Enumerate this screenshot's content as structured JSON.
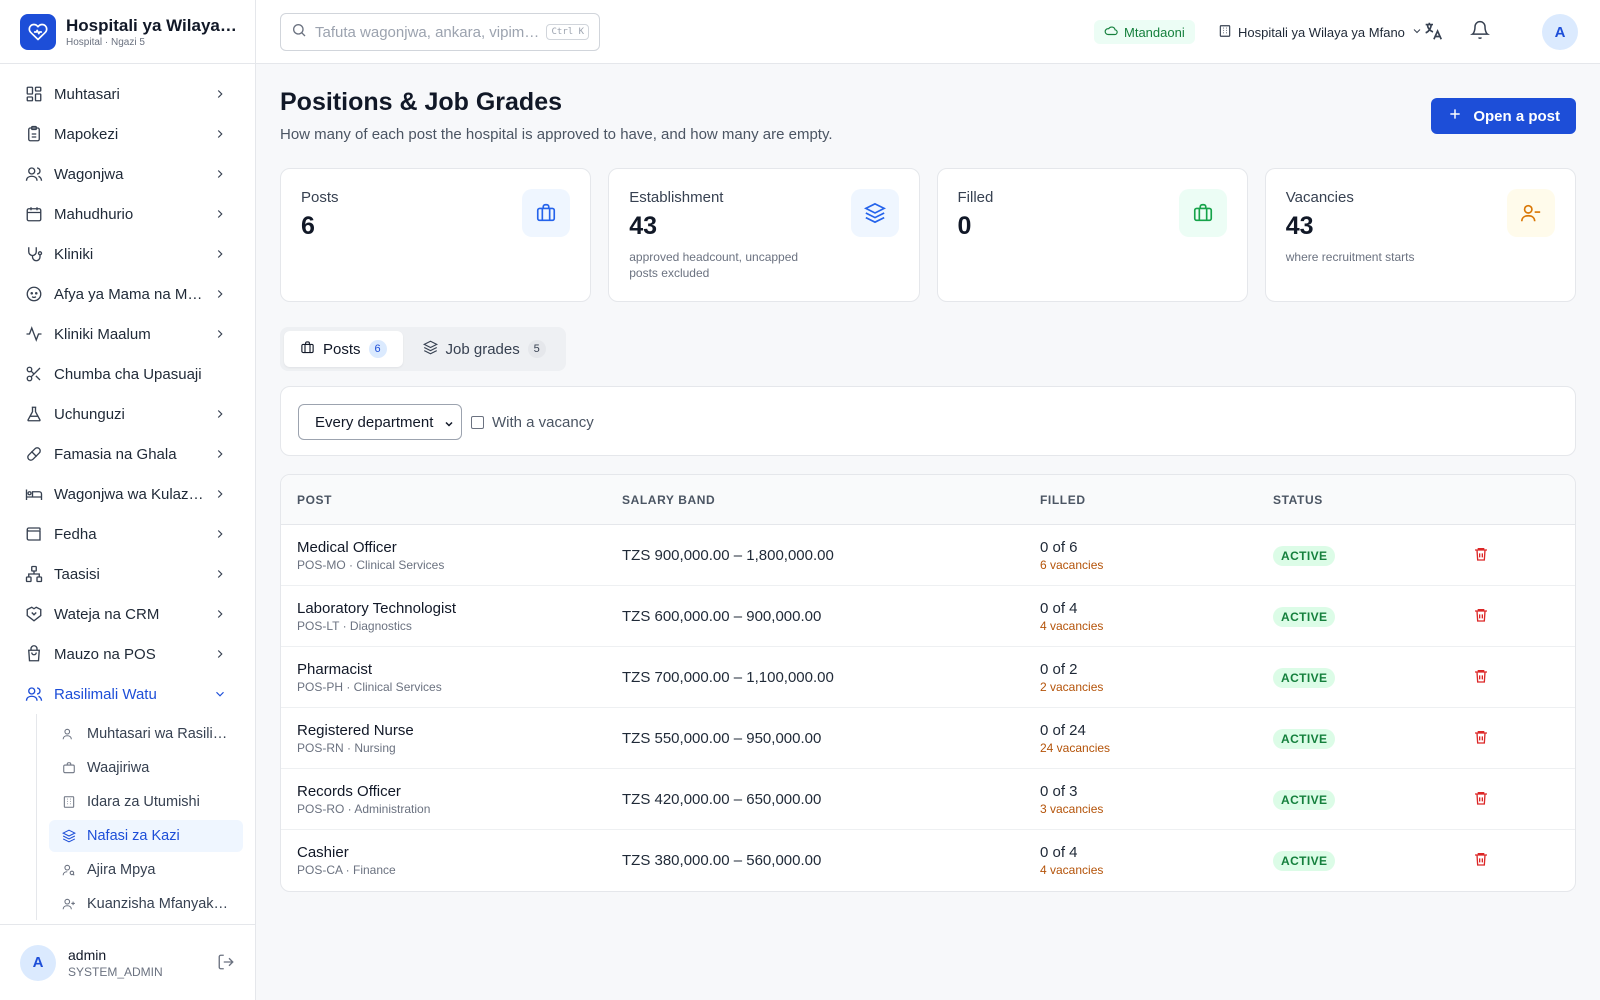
{
  "app": {
    "name": "Hospitali ya Wilaya ya Mfano",
    "subtitle": "Hospital · Ngazi 5",
    "colors": {
      "primary": "#1d4ed8",
      "success": "#15803d",
      "warning": "#b45309",
      "danger": "#dc2626"
    }
  },
  "topbar": {
    "search_placeholder": "Tafuta wagonjwa, ankara, vipimo...",
    "search_shortcut": "Ctrl K",
    "status": "Mtandaoni",
    "facility": "Hospitali ya Wilaya ya Mfano",
    "avatar_initial": "A"
  },
  "sidebar": {
    "items": [
      {
        "label": "Muhtasari",
        "icon": "dashboard-icon"
      },
      {
        "label": "Mapokezi",
        "icon": "clipboard-icon"
      },
      {
        "label": "Wagonjwa",
        "icon": "users-icon"
      },
      {
        "label": "Mahudhurio",
        "icon": "calendar-icon"
      },
      {
        "label": "Kliniki",
        "icon": "stethoscope-icon"
      },
      {
        "label": "Afya ya Mama na Mtoto",
        "icon": "baby-icon"
      },
      {
        "label": "Kliniki Maalum",
        "icon": "activity-icon"
      },
      {
        "label": "Chumba cha Upasuaji",
        "icon": "scissors-icon"
      },
      {
        "label": "Uchunguzi",
        "icon": "flask-icon"
      },
      {
        "label": "Famasia na Ghala",
        "icon": "pill-icon"
      },
      {
        "label": "Wagonjwa wa Kulazwa",
        "icon": "bed-icon"
      },
      {
        "label": "Fedha",
        "icon": "wallet-icon"
      },
      {
        "label": "Taasisi",
        "icon": "network-icon"
      },
      {
        "label": "Wateja na CRM",
        "icon": "handshake-icon"
      },
      {
        "label": "Mauzo na POS",
        "icon": "shopping-bag-icon"
      },
      {
        "label": "Rasilimali Watu",
        "icon": "users-icon"
      }
    ],
    "hr_subitems": [
      {
        "label": "Muhtasari wa Rasilimali Watu",
        "icon": "users-icon"
      },
      {
        "label": "Waajiriwa",
        "icon": "briefcase-icon"
      },
      {
        "label": "Idara za Utumishi",
        "icon": "building-icon"
      },
      {
        "label": "Nafasi za Kazi",
        "icon": "layers-icon"
      },
      {
        "label": "Ajira Mpya",
        "icon": "user-search-icon"
      },
      {
        "label": "Kuanzisha Mfanyakazi",
        "icon": "user-plus-icon"
      }
    ],
    "user": {
      "initial": "A",
      "name": "admin",
      "role": "SYSTEM_ADMIN"
    }
  },
  "page": {
    "title": "Positions & Job Grades",
    "subtitle": "How many of each post the hospital is approved to have, and how many are empty.",
    "open_button": "Open a post"
  },
  "stats": [
    {
      "label": "Posts",
      "value": "6",
      "note": "",
      "icon": "briefcase-icon"
    },
    {
      "label": "Establishment",
      "value": "43",
      "note": "approved headcount, uncapped posts excluded",
      "icon": "layers-icon"
    },
    {
      "label": "Filled",
      "value": "0",
      "note": "",
      "icon": "briefcase-icon"
    },
    {
      "label": "Vacancies",
      "value": "43",
      "note": "where recruitment starts",
      "icon": "user-minus-icon"
    }
  ],
  "tabs": [
    {
      "label": "Posts",
      "count": "6"
    },
    {
      "label": "Job grades",
      "count": "5"
    }
  ],
  "filters": {
    "department": "Every department",
    "vacancy_label": "With a vacancy"
  },
  "table": {
    "headers": {
      "post": "POST",
      "salary": "SALARY BAND",
      "filled": "FILLED",
      "status": "STATUS"
    },
    "rows": [
      {
        "name": "Medical Officer",
        "meta": "POS-MO · Clinical Services",
        "salary": "TZS 900,000.00 – 1,800,000.00",
        "filled": "0 of 6",
        "vacancies": "6 vacancies",
        "status": "ACTIVE"
      },
      {
        "name": "Laboratory Technologist",
        "meta": "POS-LT · Diagnostics",
        "salary": "TZS 600,000.00 – 900,000.00",
        "filled": "0 of 4",
        "vacancies": "4 vacancies",
        "status": "ACTIVE"
      },
      {
        "name": "Pharmacist",
        "meta": "POS-PH · Clinical Services",
        "salary": "TZS 700,000.00 – 1,100,000.00",
        "filled": "0 of 2",
        "vacancies": "2 vacancies",
        "status": "ACTIVE"
      },
      {
        "name": "Registered Nurse",
        "meta": "POS-RN · Nursing",
        "salary": "TZS 550,000.00 – 950,000.00",
        "filled": "0 of 24",
        "vacancies": "24 vacancies",
        "status": "ACTIVE"
      },
      {
        "name": "Records Officer",
        "meta": "POS-RO · Administration",
        "salary": "TZS 420,000.00 – 650,000.00",
        "filled": "0 of 3",
        "vacancies": "3 vacancies",
        "status": "ACTIVE"
      },
      {
        "name": "Cashier",
        "meta": "POS-CA · Finance",
        "salary": "TZS 380,000.00 – 560,000.00",
        "filled": "0 of 4",
        "vacancies": "4 vacancies",
        "status": "ACTIVE"
      }
    ]
  }
}
